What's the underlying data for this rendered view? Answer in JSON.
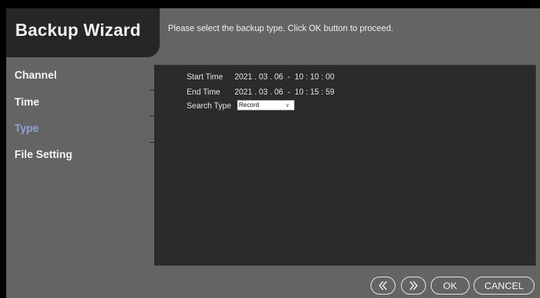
{
  "title": "Backup Wizard",
  "instruction": "Please select the backup type.  Click OK button to proceed.",
  "nav": {
    "items": [
      {
        "label": "Channel",
        "active": false
      },
      {
        "label": "Time",
        "active": false
      },
      {
        "label": "Type",
        "active": true
      },
      {
        "label": "File Setting",
        "active": false
      }
    ]
  },
  "form": {
    "start_time_label": "Start Time",
    "start_time_value": "2021 . 03 . 06  -  10 : 10 : 00",
    "end_time_label": "End Time",
    "end_time_value": "2021 . 03 . 06  -  10 : 15 : 59",
    "search_type_label": "Search Type",
    "search_type_value": "Record"
  },
  "buttons": {
    "prev_icon": "double-chevron-left-icon",
    "next_icon": "double-chevron-right-icon",
    "ok_label": "OK",
    "cancel_label": "CANCEL"
  },
  "colors": {
    "background": "#646464",
    "title_tab": "#262626",
    "panel": "#2b2b2b",
    "active_nav": "#8f9fe0"
  }
}
